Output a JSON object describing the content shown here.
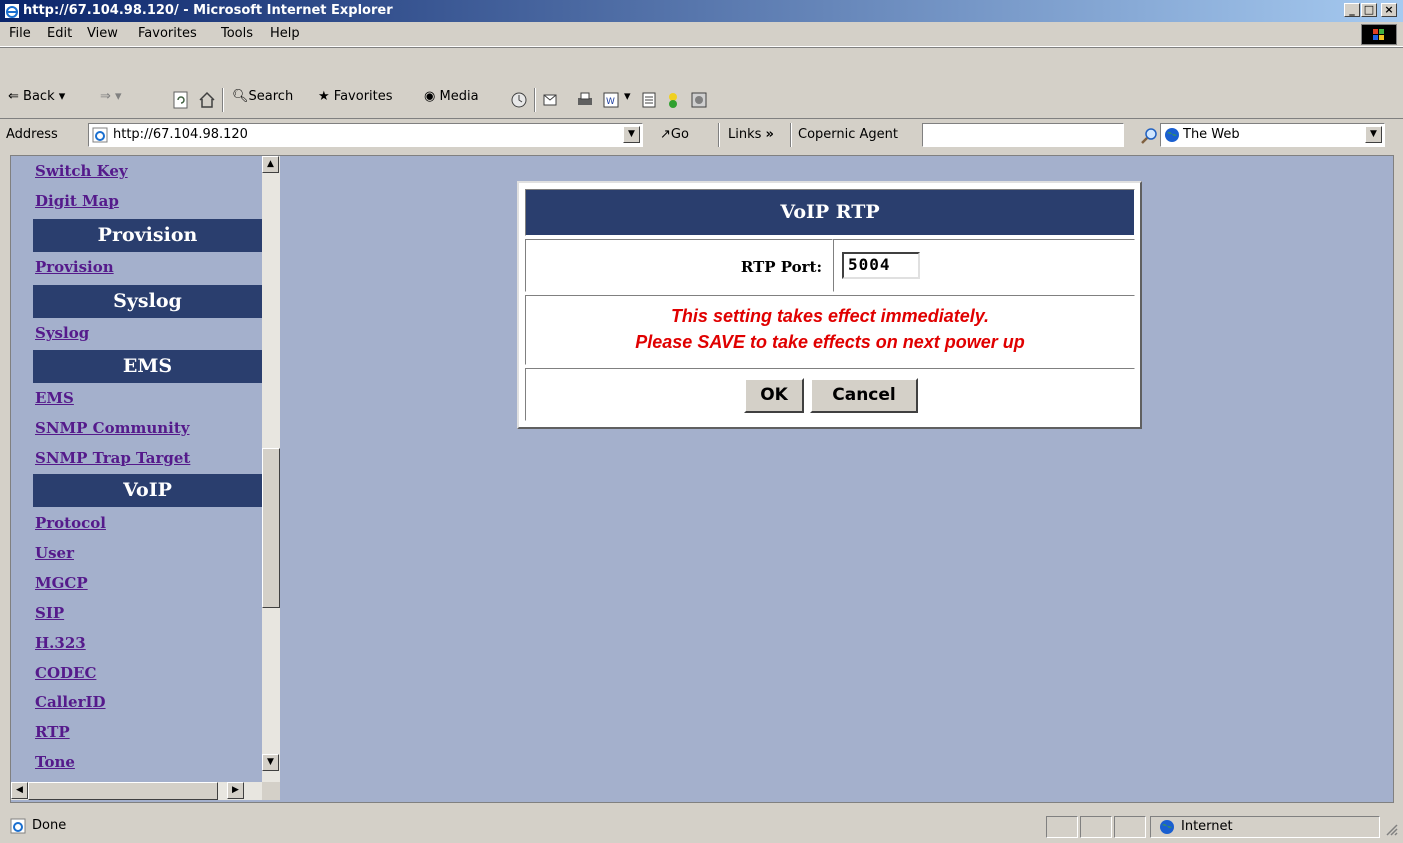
{
  "window": {
    "title": "http://67.104.98.120/ - Microsoft Internet Explorer",
    "caption_buttons": [
      "minimize-icon",
      "maximize-icon",
      "close-icon"
    ]
  },
  "menu": {
    "items": [
      "File",
      "Edit",
      "View",
      "Favorites",
      "Tools",
      "Help"
    ]
  },
  "toolbar": {
    "back_label": "Back",
    "search_label": "Search",
    "favorites_label": "Favorites",
    "media_label": "Media"
  },
  "addressbar": {
    "label": "Address",
    "url": "http://67.104.98.120",
    "go_label": "Go",
    "links_label": "Links",
    "links_chevron": "»",
    "copernic_label": "Copernic Agent",
    "copernic_value": "",
    "search_scope": "The Web"
  },
  "sidebar": {
    "items": [
      {
        "type": "link",
        "label": "Switch Key"
      },
      {
        "type": "link",
        "label": "Digit Map"
      },
      {
        "type": "header",
        "label": "Provision"
      },
      {
        "type": "link",
        "label": "Provision"
      },
      {
        "type": "header",
        "label": "Syslog"
      },
      {
        "type": "link",
        "label": "Syslog"
      },
      {
        "type": "header",
        "label": "EMS"
      },
      {
        "type": "link",
        "label": "EMS"
      },
      {
        "type": "link",
        "label": "SNMP Community"
      },
      {
        "type": "link",
        "label": "SNMP Trap Target"
      },
      {
        "type": "header",
        "label": "VoIP"
      },
      {
        "type": "link",
        "label": "Protocol"
      },
      {
        "type": "link",
        "label": "User"
      },
      {
        "type": "link",
        "label": "MGCP"
      },
      {
        "type": "link",
        "label": "SIP"
      },
      {
        "type": "link",
        "label": "H.323"
      },
      {
        "type": "link",
        "label": "CODEC"
      },
      {
        "type": "link",
        "label": "CallerID"
      },
      {
        "type": "link",
        "label": "RTP"
      },
      {
        "type": "link",
        "label": "Tone"
      }
    ]
  },
  "dialog": {
    "title": "VoIP RTP",
    "rtp_port_label": "RTP Port:",
    "rtp_port_value": "5004",
    "message_line1": "This setting takes effect immediately.",
    "message_line2": "Please SAVE to take effects on next power up",
    "ok_label": "OK",
    "cancel_label": "Cancel"
  },
  "status": {
    "text": "Done",
    "zone": "Internet"
  },
  "colors": {
    "content_bg": "#a4b0cc",
    "nav_header_bg": "#2a3e6e",
    "link_color": "#551a8b",
    "message_color": "#e00000"
  }
}
